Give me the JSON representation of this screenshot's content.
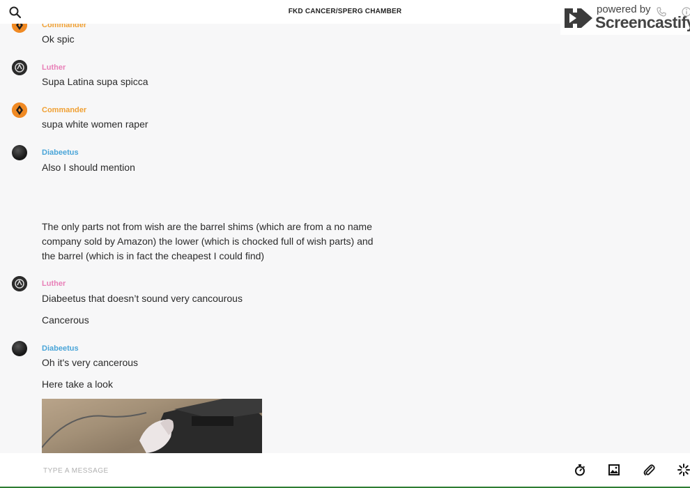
{
  "header": {
    "title": "FKD CANCER/SPERG CHAMBER",
    "search_icon": "search-icon"
  },
  "watermark": {
    "powered": "powered by",
    "brand": "Screencastify"
  },
  "messages": [
    {
      "sender": "Commander",
      "text": "Ok spic",
      "color": "#f0a033"
    },
    {
      "sender": "Luther",
      "text": "Supa Latina supa spicca",
      "color": "#e880b8"
    },
    {
      "sender": "Commander",
      "text": "supa white women raper",
      "color": "#f0a033"
    },
    {
      "sender": "Diabeetus",
      "text": "Also I should mention",
      "color": "#4aa5d8"
    },
    {
      "text_line1": "The only parts not from wish are the barrel shims (which are from a no name",
      "text_line2": "company sold by Amazon) the lower (which is chocked full of wish parts) and",
      "text_line3": "the barrel (which is in fact the cheapest I could find)"
    },
    {
      "sender": "Luther",
      "text": "Diabeetus that doesn’t sound very cancourous",
      "color": "#e880b8"
    },
    {
      "text": "Cancerous"
    },
    {
      "sender": "Diabeetus",
      "text": "Oh it's very cancerous",
      "color": "#4aa5d8"
    },
    {
      "text": "Here take a look"
    }
  ],
  "composer": {
    "placeholder": "TYPE A MESSAGE",
    "tools": [
      "timer-icon",
      "image-icon",
      "paperclip-icon",
      "loading-spinner-icon"
    ]
  }
}
